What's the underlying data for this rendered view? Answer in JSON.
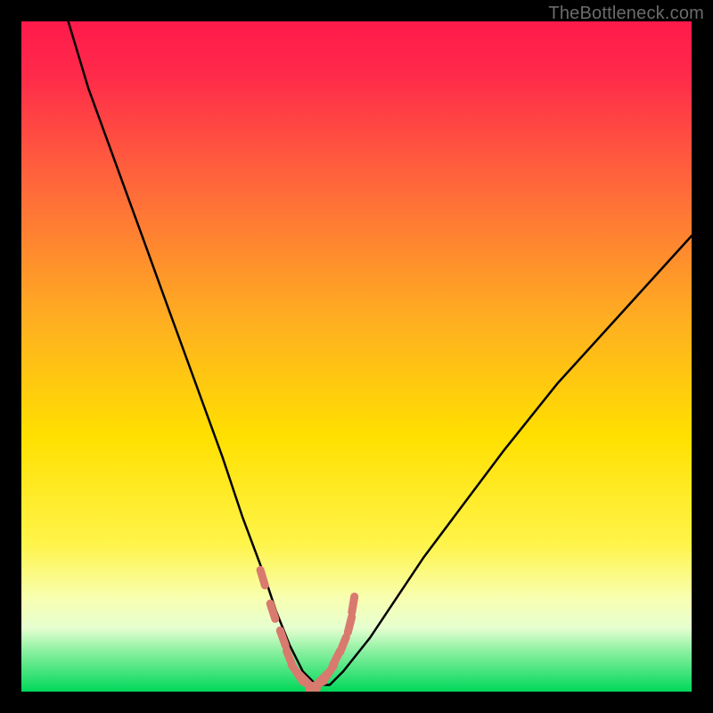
{
  "watermark": "TheBottleneck.com",
  "colors": {
    "bg_black": "#000000",
    "grad_top": "#ff1a4b",
    "grad_mid": "#ffd400",
    "grad_bottom": "#00e060",
    "curve": "#000000",
    "markers": "#d97a6f",
    "watermark": "#6b6b6b"
  },
  "chart_data": {
    "type": "line",
    "title": "",
    "xlabel": "",
    "ylabel": "",
    "xlim": [
      0,
      100
    ],
    "ylim": [
      0,
      100
    ],
    "series": [
      {
        "name": "bottleneck-curve",
        "x": [
          7,
          10,
          14,
          18,
          22,
          26,
          30,
          33,
          36,
          38,
          40,
          42,
          44,
          46,
          48,
          52,
          56,
          60,
          66,
          72,
          80,
          90,
          100
        ],
        "y": [
          100,
          90,
          79,
          68,
          57,
          46,
          35,
          26,
          18,
          12,
          7,
          3,
          1,
          1,
          3,
          8,
          14,
          20,
          28,
          36,
          46,
          57,
          68
        ]
      }
    ],
    "markers": {
      "name": "highlight",
      "x": [
        36,
        37.5,
        39,
        40,
        41,
        42,
        43,
        44,
        45,
        46,
        47,
        48,
        49,
        49.5
      ],
      "y": [
        17,
        12,
        8,
        5,
        3,
        2,
        1,
        1,
        2,
        3,
        5,
        7,
        10,
        13
      ]
    },
    "min_point": {
      "x": 44,
      "y": 1
    }
  }
}
